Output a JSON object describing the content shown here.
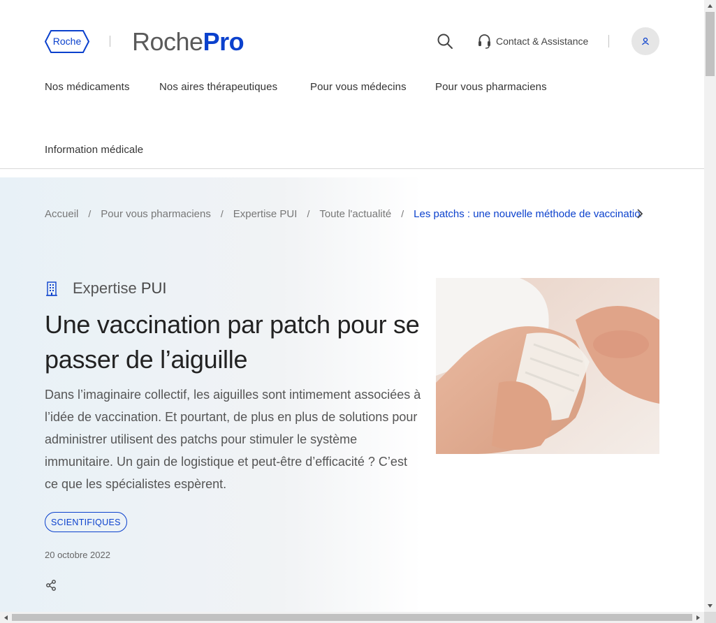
{
  "header": {
    "roche_logo_text": "Roche",
    "brand_prefix": "Roche",
    "brand_suffix": "Pro",
    "contact_label": "Contact & Assistance",
    "icons": {
      "search": "search-icon",
      "contact": "headset-icon",
      "account": "user-icon"
    }
  },
  "nav": {
    "items": [
      "Nos médicaments",
      "Nos aires thérapeutiques",
      "Pour vous médecins",
      "Pour vous pharmaciens",
      "Information médicale"
    ]
  },
  "breadcrumb": {
    "items": [
      "Accueil",
      "Pour vous pharmaciens",
      "Expertise PUI",
      "Toute l'actualité"
    ],
    "separator": "/",
    "current": "Les patchs : une nouvelle méthode de vaccination"
  },
  "article": {
    "kicker_prefix": "Expertise",
    "kicker_suffix": "PUI",
    "title": "Une vaccination par patch pour se passer de l’aiguille",
    "lead": "Dans l’imaginaire collectif, les aiguilles sont intimement associées à l’idée de vaccination. Et pourtant, de plus en plus de solutions pour administrer utilisent des patchs pour stimuler le système immunitaire. Un gain de logistique et peut-être d’efficacité ? C’est ce que les spécialistes espèrent.",
    "tag": "SCIENTIFIQUES",
    "date": "20 octobre 2022"
  },
  "colors": {
    "brand_blue": "#0b41cd",
    "text": "#2a2a2a",
    "muted": "#777777",
    "hero_gradient_start": "#e8f1f7"
  }
}
